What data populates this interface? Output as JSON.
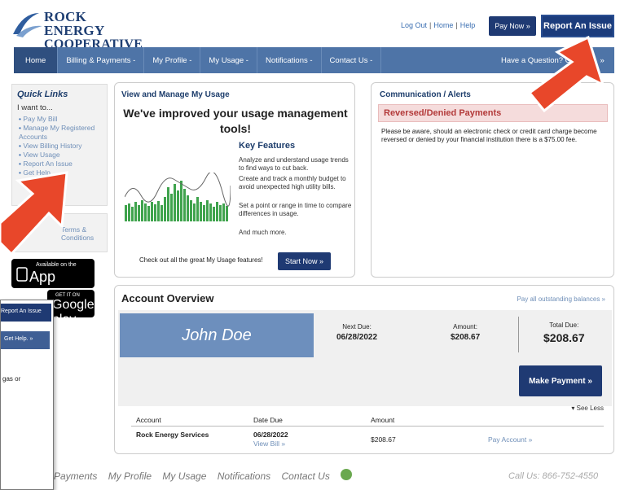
{
  "brand": {
    "line1": "ROCK ENERGY",
    "line2": "COOPERATIVE"
  },
  "toplinks": [
    "Log Out",
    "Home",
    "Help"
  ],
  "buttons": {
    "pay_now": "Pay Now »",
    "report_issue": "Report An Issue"
  },
  "nav": {
    "items": [
      "Home",
      "Billing & Payments -",
      "My Profile -",
      "My Usage -",
      "Notifications -",
      "Contact Us -"
    ],
    "help": "Have a Question? Get Help. »"
  },
  "quick_links": {
    "title": "Quick Links",
    "subtitle": "I want to...",
    "items": [
      "Pay My Bill",
      "Manage My Registered Accounts",
      "View Billing History",
      "View Usage",
      "Report An Issue",
      "Get Help"
    ]
  },
  "terms": {
    "label": "Terms & Conditions"
  },
  "app_store": {
    "small": "Available on the",
    "big": "App Store"
  },
  "google_play": {
    "small": "GET IT ON",
    "big": "Google play"
  },
  "usage": {
    "title": "View and Manage My Usage",
    "headline": "We've improved your usage management tools!",
    "key_features": "Key Features",
    "features": [
      "Analyze and understand usage trends to find ways to cut back.",
      "Create and track a monthly budget to avoid unexpected high utility bills.",
      "Set a point or range in time to compare differences in usage.",
      "And much more."
    ],
    "checkout": "Check out all the great My Usage features!",
    "start_now": "Start Now »"
  },
  "alerts": {
    "title": "Communication / Alerts",
    "heading": "Reversed/Denied Payments",
    "text": "Please be aware, should an electronic check or credit card charge become reversed or denied by your financial institution there is a $75.00 fee."
  },
  "account": {
    "title": "Account Overview",
    "pay_all": "Pay all outstanding balances »",
    "name": "John Doe",
    "next_due_label": "Next Due:",
    "next_due": "06/28/2022",
    "amount_label": "Amount:",
    "amount": "$208.67",
    "total_due_label": "Total Due:",
    "total_due": "$208.67",
    "make_payment": "Make Payment »",
    "see_less": "▾ See Less",
    "table_headers": [
      "Account",
      "Date Due",
      "Amount"
    ],
    "row": {
      "account": "Rock Energy Services",
      "date": "06/28/2022",
      "view_bill": "View Bill »",
      "amount": "$208.67",
      "pay_account": "Pay Account »"
    }
  },
  "footer": {
    "links": [
      "Payments",
      "My Profile",
      "My Usage",
      "Notifications",
      "Contact Us"
    ],
    "call_us": "Call Us: 866-752-4550"
  },
  "inset": {
    "report": "Report An Issue",
    "help": "Get Help. »",
    "text": "gas or"
  },
  "colors": {
    "nav": "#4e74a7",
    "button": "#1f3a73",
    "arrow": "#e8472a",
    "alert_bg": "#f5dcdc"
  }
}
